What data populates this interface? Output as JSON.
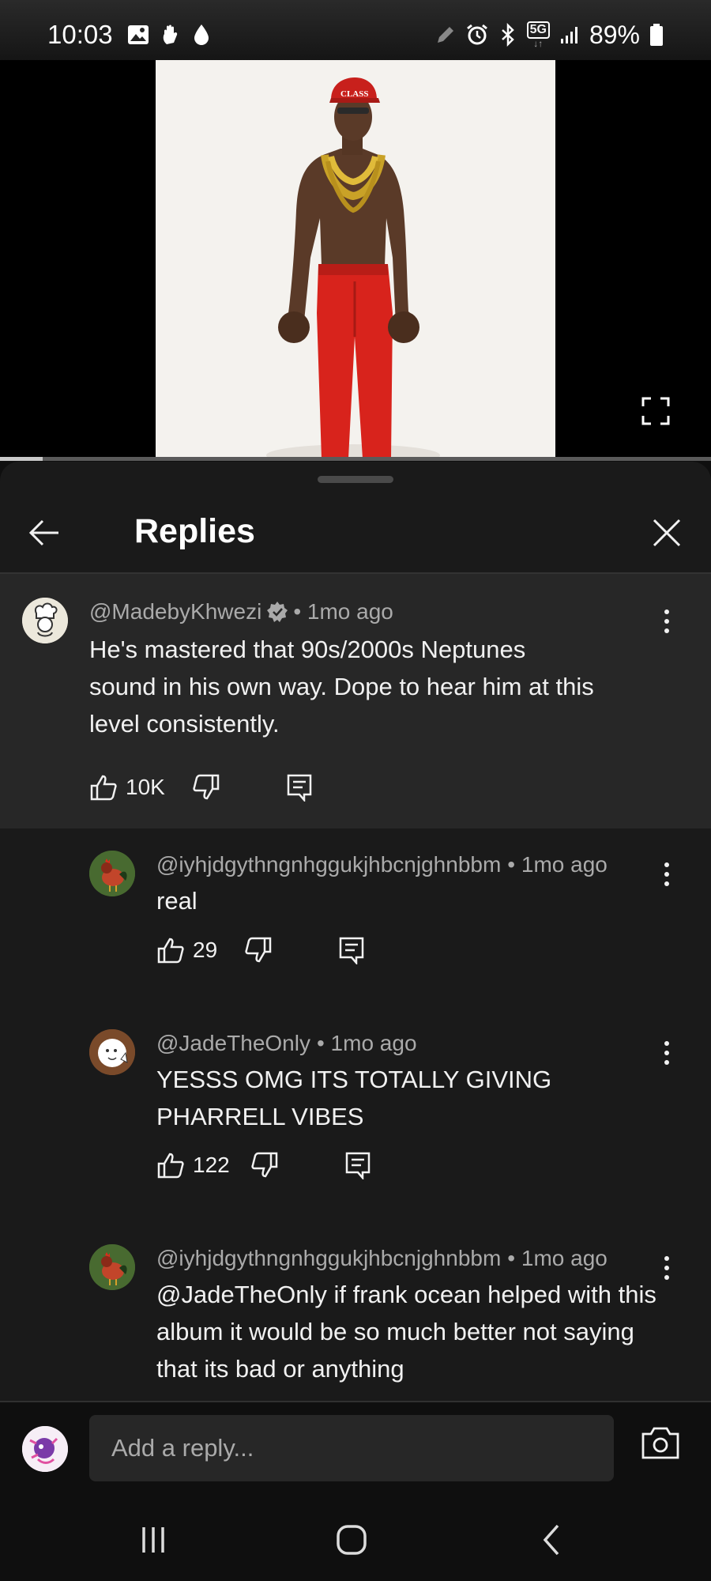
{
  "status_bar": {
    "time": "10:03",
    "battery_percent": "89%",
    "network": "5G",
    "left_icons": [
      "gallery-icon",
      "hand-icon",
      "water-drop-icon"
    ],
    "right_icons": [
      "pen-icon",
      "alarm-icon",
      "bluetooth-icon",
      "5g-icon",
      "signal-icon",
      "battery-icon"
    ]
  },
  "video": {
    "progress": 0.06,
    "fullscreen_icon": "fullscreen-icon",
    "cap_text": "CLASS"
  },
  "sheet": {
    "title": "Replies",
    "back_icon": "arrow-left-icon",
    "close_icon": "close-icon"
  },
  "parent_comment": {
    "author": "@MadebyKhwezi",
    "verified_icon": "verified-badge-icon",
    "time": "• 1mo ago",
    "text": "He's mastered that 90s/2000s Neptunes sound in his own way. Dope to hear him at this level consistently.",
    "likes": "10K"
  },
  "replies": [
    {
      "author": "@iyhjdgythngnhggukjhbcnjghnbbm",
      "time": "• 1mo ago",
      "text": "real",
      "likes": "29"
    },
    {
      "author": "@JadeTheOnly",
      "time": "• 1mo ago",
      "text": "YESSS OMG ITS TOTALLY GIVING PHARRELL VIBES",
      "likes": "122"
    },
    {
      "author": "@iyhjdgythngnhggukjhbcnjghnbbm",
      "time": "• 1mo ago",
      "text": "@JadeTheOnly if frank ocean helped with this album it would be so much better not saying that its bad or anything"
    }
  ],
  "reply_bar": {
    "placeholder": "Add a reply...",
    "camera_icon": "camera-icon"
  },
  "nav_bar": {
    "buttons": [
      "recent-apps-icon",
      "home-icon",
      "back-icon"
    ]
  },
  "colors": {
    "background": "#0f0f0f",
    "sheet": "#1a1a1a",
    "highlight": "#272727",
    "text_primary": "#f1f1f1",
    "text_secondary": "#aaaaaa",
    "pants_red": "#d8231c",
    "cap_red": "#c8201c"
  }
}
